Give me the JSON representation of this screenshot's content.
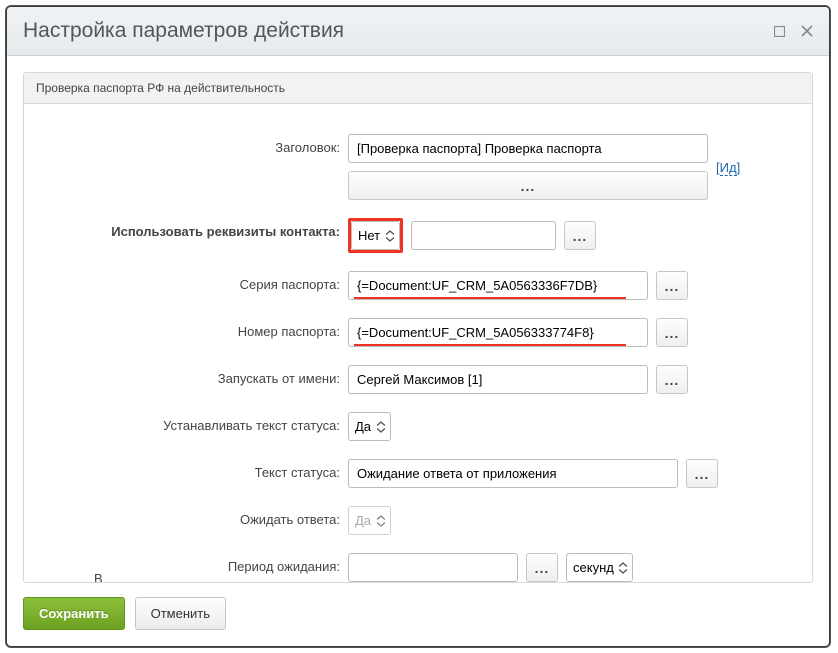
{
  "header": {
    "title": "Настройка параметров действия"
  },
  "section": {
    "title": "Проверка паспорта РФ на действительность"
  },
  "form": {
    "heading_label": "Заголовок:",
    "heading_value": "[Проверка паспорта] Проверка паспорта",
    "id_link_open": "[",
    "id_link_text": "Ид",
    "id_link_close": "]",
    "use_contact_label": "Использовать реквизиты контакта:",
    "use_contact_value": "Нет",
    "passport_series_label": "Серия паспорта:",
    "passport_series_value": "{=Document:UF_CRM_5A0563336F7DB}",
    "passport_number_label": "Номер паспорта:",
    "passport_number_value": "{=Document:UF_CRM_5A056333774F8}",
    "run_as_label": "Запускать от имени:",
    "run_as_value": "Сергей Максимов [1]",
    "set_status_label": "Устанавливать текст статуса:",
    "set_status_value": "Да",
    "status_text_label": "Текст статуса:",
    "status_text_value": "Ожидание ответа от приложения",
    "wait_reply_label": "Ожидать ответа:",
    "wait_reply_value": "Да",
    "wait_period_label": "Период ожидания:",
    "wait_period_value": "",
    "wait_unit_value": "секунд",
    "truncated_row_label_fragment": "В"
  },
  "buttons": {
    "dots": "...",
    "save": "Сохранить",
    "cancel": "Отменить"
  }
}
